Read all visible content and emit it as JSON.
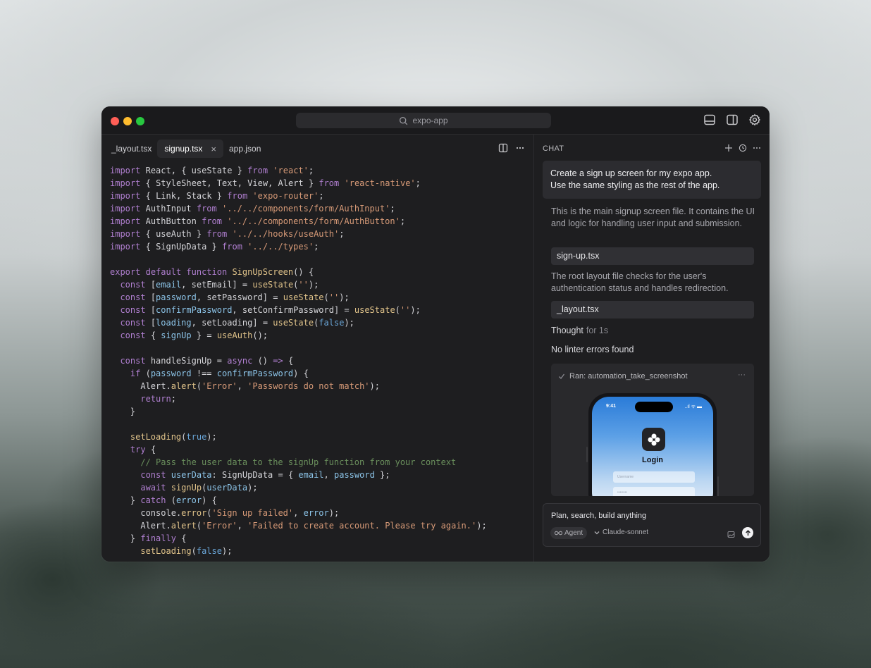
{
  "window": {
    "search_text": "expo-app",
    "traffic_colors": [
      "#ff5f57",
      "#febc2e",
      "#28c840"
    ]
  },
  "editor": {
    "tabs": [
      {
        "label": "_layout.tsx",
        "active": false
      },
      {
        "label": "signup.tsx",
        "active": true,
        "close": "×"
      },
      {
        "label": "app.json",
        "active": false
      }
    ],
    "code_lines": [
      "import React, { useState } from 'react';",
      "import { StyleSheet, Text, View, Alert } from 'react-native';",
      "import { Link, Stack } from 'expo-router';",
      "import AuthInput from '../../components/form/AuthInput';",
      "import AuthButton from '../../components/form/AuthButton';",
      "import { useAuth } from '../../hooks/useAuth';",
      "import { SignUpData } from '../../types';",
      "",
      "export default function SignUpScreen() {",
      "  const [email, setEmail] = useState('');",
      "  const [password, setPassword] = useState('');",
      "  const [confirmPassword, setConfirmPassword] = useState('');",
      "  const [loading, setLoading] = useState(false);",
      "  const { signUp } = useAuth();",
      "",
      "  const handleSignUp = async () => {",
      "    if (password !== confirmPassword) {",
      "      Alert.alert('Error', 'Passwords do not match');",
      "      return;",
      "    }",
      "",
      "    setLoading(true);",
      "    try {",
      "      // Pass the user data to the signUp function from your context",
      "      const userData: SignUpData = { email, password };",
      "      await signUp(userData);",
      "    } catch (error) {",
      "      console.error('Sign up failed', error);",
      "      Alert.alert('Error', 'Failed to create account. Please try again.');",
      "    } finally {",
      "      setLoading(false);"
    ]
  },
  "chat": {
    "header": "CHAT",
    "user_message_line1": "Create a sign up screen for my expo app.",
    "user_message_line2": "Use the same styling as the rest of the app.",
    "reply1": "This is the main signup screen file. It contains the UI and logic for handling user input and submission.",
    "file1": "sign-up.tsx",
    "reply2": "The root layout file checks for the user's authentication status and handles redirection.",
    "file2": "_layout.tsx",
    "thought_label": "Thought",
    "thought_time": "for 1s",
    "linter": "No linter errors found",
    "tool_label": "Ran: automation_take_screenshot",
    "tool_more": "···",
    "phone": {
      "time": "9:41",
      "status": "..ıl ᯤ ▬",
      "title": "Login",
      "username_placeholder": "Username",
      "password_placeholder": "••••••••"
    },
    "composer": {
      "placeholder": "Plan, search, build anything",
      "agent_label": "Agent",
      "model_label": "Claude-sonnet"
    }
  }
}
